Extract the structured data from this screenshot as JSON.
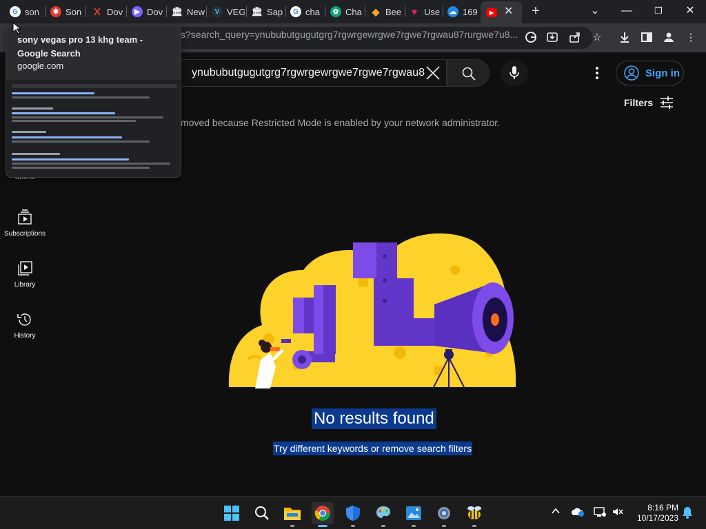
{
  "browser": {
    "tabs": [
      {
        "label": "son",
        "icon": "google-icon",
        "color": "#4285f4"
      },
      {
        "label": "Son",
        "icon": "sony-red-icon",
        "color": "#e53935"
      },
      {
        "label": "Dov",
        "icon": "x-red-icon",
        "color": "#e53935"
      },
      {
        "label": "Dov",
        "icon": "download-site-icon",
        "color": "#7b61ff"
      },
      {
        "label": "New",
        "icon": "bank-icon",
        "color": "#e8eaed"
      },
      {
        "label": "VEG",
        "icon": "v-icon",
        "color": "#4fc3f7"
      },
      {
        "label": "Sap",
        "icon": "bank-icon",
        "color": "#e8eaed"
      },
      {
        "label": "cha",
        "icon": "google-icon",
        "color": "#4285f4"
      },
      {
        "label": "Cha",
        "icon": "chatgpt-icon",
        "color": "#10a37f"
      },
      {
        "label": "Bee",
        "icon": "bee-icon",
        "color": "#f5a623"
      },
      {
        "label": "Use",
        "icon": "heart-icon",
        "color": "#e91e63"
      },
      {
        "label": "169",
        "icon": "cloud-icon",
        "color": "#42a5f5"
      },
      {
        "label": "",
        "icon": "youtube-icon",
        "color": "#ff0000"
      }
    ],
    "url": "s?search_query=ynububutgugutgrg7rgwrgewrgwe7rgwe7rgwau87rurgwe7u8..."
  },
  "hovercard": {
    "title": "sony vegas pro 13 khg team - Google Search",
    "domain": "google.com"
  },
  "youtube": {
    "search_value": "ynububutgugutgrg7rgwrgewrgwe7rgwe7rgwau8",
    "signin_label": "Sign in",
    "filters_label": "Filters",
    "restricted_notice": "moved because Restricted Mode is enabled by your network administrator.",
    "nav": [
      {
        "label": "Shorts",
        "icon": "shorts-icon"
      },
      {
        "label": "Subscriptions",
        "icon": "subscriptions-icon"
      },
      {
        "label": "Library",
        "icon": "library-icon"
      },
      {
        "label": "History",
        "icon": "history-icon"
      }
    ],
    "no_results_title": "No results found",
    "no_results_hint": "Try different keywords or remove search filters"
  },
  "taskbar": {
    "apps": [
      "start-icon",
      "search-icon",
      "file-explorer-icon",
      "chrome-icon",
      "defender-icon",
      "paint-icon",
      "photos-icon",
      "settings-icon",
      "bee-app-icon"
    ],
    "time": "8:16 PM",
    "date": "10/17/2023"
  }
}
